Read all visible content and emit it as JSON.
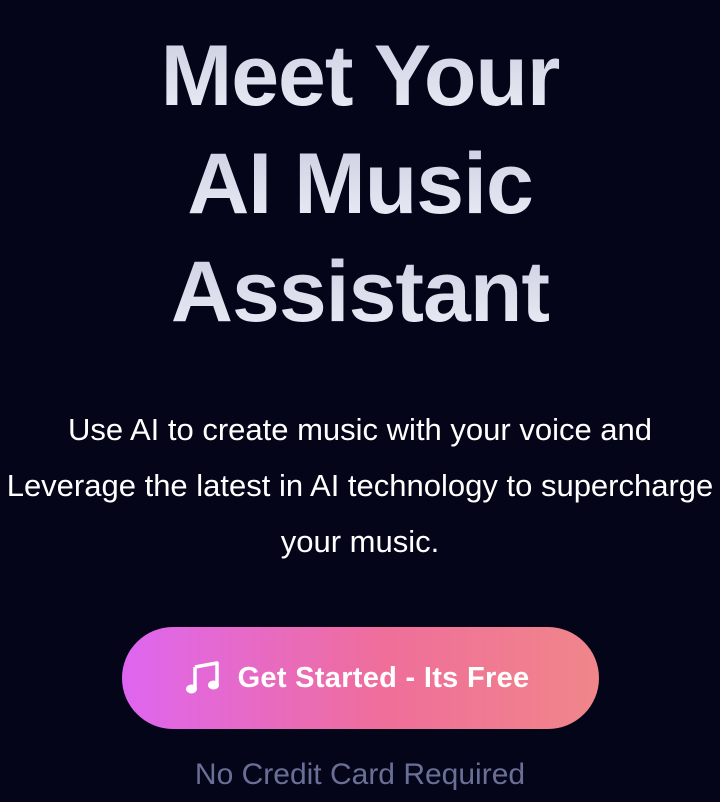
{
  "hero": {
    "headline_lines": [
      "Meet Your",
      "AI Music",
      "Assistant"
    ],
    "subtitle": "Use AI to create music with your voice and Leverage the latest in AI technology to supercharge your music.",
    "cta": {
      "icon": "music-note-icon",
      "label": "Get Started - Its Free",
      "gradient": [
        "#de66f0",
        "#ef6e9a",
        "#f0868a"
      ]
    },
    "note": "No Credit Card Required"
  },
  "colors": {
    "background": "#05051a",
    "headline": "#e2e4f0",
    "note": "#6a6f95"
  }
}
